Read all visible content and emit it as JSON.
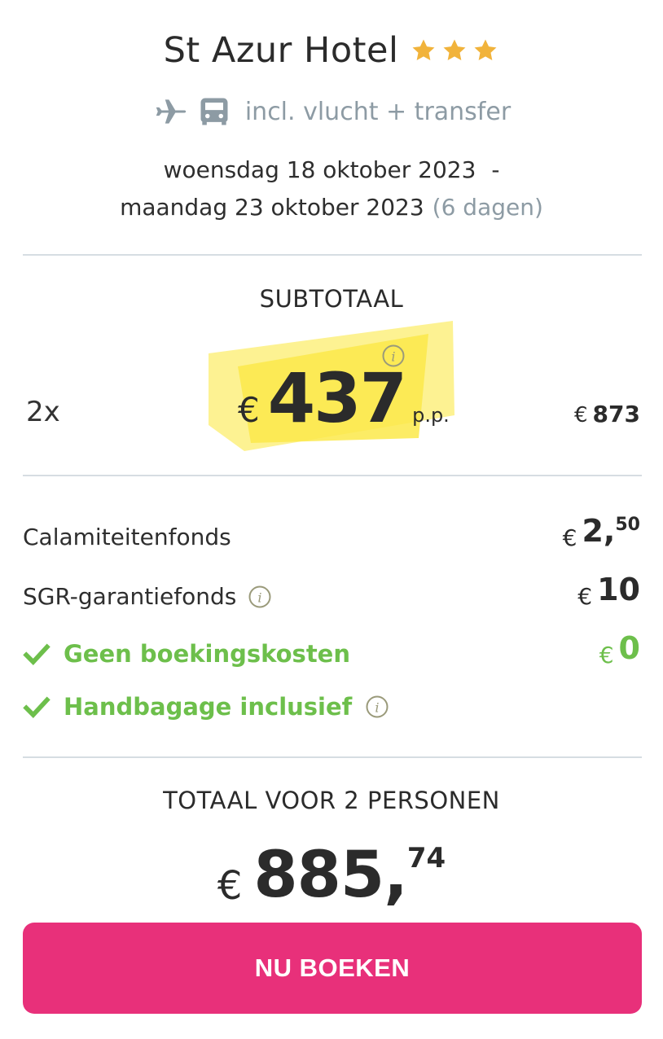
{
  "hotel": {
    "name": "St Azur Hotel",
    "stars": 3,
    "star_color": "#f1b33b"
  },
  "inclusions": {
    "icons": [
      "plane-icon",
      "bus-icon"
    ],
    "text": "incl. vlucht + transfer"
  },
  "dates": {
    "start": "woensdag 18 oktober 2023",
    "separator": "-",
    "end": "maandag 23 oktober 2023",
    "duration": "(6 dagen)"
  },
  "subtotal": {
    "label": "SUBTOTAAL",
    "quantity": "2x",
    "currency": "€",
    "price_per_person": "437",
    "unit": "p.p.",
    "total_currency": "€",
    "total": "873",
    "highlight_color": "#fbe94a"
  },
  "fees": [
    {
      "label": "Calamiteitenfonds",
      "currency": "€",
      "whole": "2,",
      "cents": "50"
    },
    {
      "label": "SGR-garantiefonds",
      "currency": "€",
      "whole": "10",
      "cents": ""
    }
  ],
  "included": [
    {
      "label": "Geen boekingskosten",
      "currency": "€",
      "amount": "0"
    },
    {
      "label": "Handbagage inclusief"
    }
  ],
  "total": {
    "label": "TOTAAL VOOR 2 PERSONEN",
    "currency": "€",
    "whole": "885,",
    "cents": "74"
  },
  "cta": {
    "label": "NU BOEKEN",
    "color": "#e8307a"
  },
  "colors": {
    "accent_green": "#6dbf4b",
    "muted": "#8d9ba4",
    "divider": "#d6dde2"
  }
}
